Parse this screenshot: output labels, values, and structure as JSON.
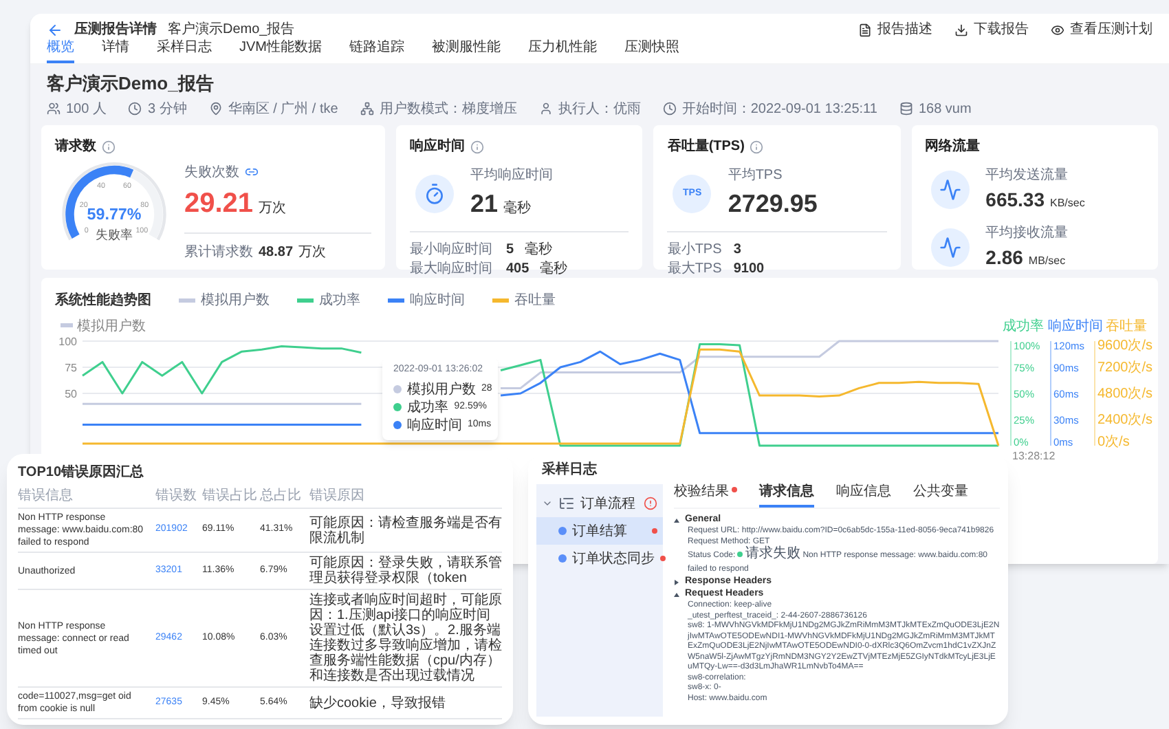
{
  "header": {
    "title": "压测报告详情",
    "subtitle": "客户演示Demo_报告",
    "actions": [
      "报告描述",
      "下载报告",
      "查看压测计划"
    ]
  },
  "tabs": [
    {
      "label": "概览",
      "selected": true
    },
    {
      "label": "详情",
      "selected": false
    },
    {
      "label": "采样日志",
      "selected": false
    },
    {
      "label": "JVM性能数据",
      "selected": false
    },
    {
      "label": "链路追踪",
      "selected": false
    },
    {
      "label": "被测服性能",
      "selected": false
    },
    {
      "label": "压力机性能",
      "selected": false
    },
    {
      "label": "压测快照",
      "selected": false
    }
  ],
  "report": {
    "title": "客户演示Demo_报告",
    "meta": [
      "100 人",
      "3 分钟",
      "华南区 / 广州 / tke",
      "用户数模式：梯度增压",
      "执行人：优雨",
      "开始时间：2022-09-01 13:25:11",
      "168 vum"
    ]
  },
  "requests_card": {
    "title": "请求数",
    "gauge": {
      "level": 0.5977,
      "value": "59.77%",
      "label": "失败率",
      "ticks": [
        "0",
        "20",
        "40",
        "60",
        "80",
        "100"
      ]
    },
    "failures": {
      "label": "失败次数",
      "value": "29.21",
      "unit": "万次"
    },
    "total": {
      "label": "累计请求数",
      "value": "48.87",
      "unit": "万次"
    }
  },
  "response_card": {
    "title": "响应时间",
    "average": {
      "label": "平均响应时间",
      "value": "21",
      "unit": "毫秒"
    },
    "min": {
      "label": "最小响应时间",
      "value": "5",
      "unit": "毫秒"
    },
    "max": {
      "label": "最大响应时间",
      "value": "405",
      "unit": "毫秒"
    }
  },
  "tps_card": {
    "title": "吞吐量(TPS)",
    "badge": "TPS",
    "average": {
      "label": "平均TPS",
      "value": "2729.95"
    },
    "min": {
      "label": "最小TPS",
      "value": "3"
    },
    "max": {
      "label": "最大TPS",
      "value": "9100"
    }
  },
  "network_card": {
    "title": "网络流量",
    "items": [
      {
        "label": "平均发送流量",
        "value": "665.33",
        "unit": "KB/sec"
      },
      {
        "label": "平均接收流量",
        "value": "2.86",
        "unit": "MB/sec"
      }
    ]
  },
  "trend_chart": {
    "title": "系统性能趋势图",
    "chart_data": {
      "type": "line",
      "ylabel": "模拟用户数",
      "categories": [
        null,
        null,
        null,
        null,
        null,
        null,
        null,
        null,
        null,
        null,
        null,
        null,
        null,
        null,
        null,
        null,
        null,
        null,
        null,
        null,
        null,
        null,
        null,
        null,
        null,
        null,
        null,
        null,
        null,
        null,
        null,
        null,
        null,
        null,
        null,
        null,
        null,
        null,
        null,
        null,
        null,
        null,
        null,
        null,
        null,
        null,
        null
      ],
      "ylim": [
        0,
        100
      ],
      "yticks": [
        50,
        75,
        100
      ],
      "series": [
        {
          "name": "模拟用户数",
          "color": "#c5cbe0",
          "values": [
            40,
            40,
            40,
            40,
            40,
            40,
            40,
            40,
            40,
            40,
            40,
            40,
            40,
            40,
            40,
            null,
            null,
            null,
            null,
            null,
            null,
            55,
            55,
            70,
            70,
            70,
            70,
            70,
            70,
            70,
            70,
            85,
            85,
            85,
            85,
            85,
            85,
            85,
            100,
            100,
            100,
            100,
            100,
            100,
            100,
            100,
            100
          ]
        },
        {
          "name": "成功率",
          "color": "#3fcf8e",
          "values": [
            67,
            80,
            50,
            80,
            67,
            80,
            50,
            80,
            90,
            92,
            95,
            94,
            93,
            93,
            89,
            null,
            null,
            null,
            null,
            null,
            null,
            72,
            77,
            82,
            0,
            0,
            0,
            0,
            0,
            0,
            0,
            97,
            97,
            96,
            0,
            0,
            0,
            0,
            0,
            0,
            0,
            0,
            0,
            0,
            0,
            0,
            0
          ]
        },
        {
          "name": "响应时间",
          "color": "#3b82f6",
          "values": [
            20,
            20,
            20,
            20,
            20,
            20,
            20,
            20,
            20,
            20,
            20,
            20,
            20,
            20,
            20,
            null,
            null,
            null,
            null,
            null,
            null,
            48,
            50,
            60,
            75,
            80,
            90,
            78,
            82,
            88,
            82,
            12,
            12,
            12,
            12,
            12,
            12,
            12,
            12,
            12,
            12,
            12,
            12,
            12,
            12,
            12,
            12
          ]
        },
        {
          "name": "吞吐量",
          "color": "#f5b82e",
          "values": [
            2,
            2,
            2,
            2,
            2,
            2,
            2,
            2,
            2,
            2,
            2,
            2,
            2,
            2,
            2,
            2,
            2,
            2,
            2,
            2,
            2,
            2,
            2,
            2,
            2,
            2,
            2,
            2,
            2,
            2,
            2,
            92,
            92,
            90,
            48,
            48,
            48,
            47,
            48,
            55,
            60,
            60,
            61,
            60,
            60,
            59,
            0
          ]
        }
      ]
    },
    "x_label": "13:28:12",
    "right_axes": [
      {
        "label": "成功率",
        "color": "#3fcf8e",
        "ticks": [
          "100%",
          "75%",
          "50%",
          "25%",
          "0%"
        ]
      },
      {
        "label": "响应时间",
        "color": "#3b82f6",
        "ticks": [
          "120ms",
          "90ms",
          "60ms",
          "30ms",
          "0ms"
        ]
      },
      {
        "label": "吞吐量",
        "color": "#f5b82e",
        "ticks": [
          "9600次/s",
          "7200次/s",
          "4800次/s",
          "2400次/s",
          "0次/s"
        ]
      }
    ],
    "tooltip": {
      "time": "2022-09-01 13:26:02",
      "rows": [
        {
          "label": "模拟用户数",
          "value": "28",
          "color": "#c5cbe0"
        },
        {
          "label": "成功率",
          "value": "92.59%",
          "color": "#3fcf8e"
        },
        {
          "label": "响应时间",
          "value": "10ms",
          "color": "#3b82f6"
        }
      ]
    }
  },
  "error_summary": {
    "title": "TOP10错误原因汇总",
    "columns": [
      "错误信息",
      "错误数",
      "错误占比",
      "总占比",
      "错误原因"
    ],
    "rows": [
      {
        "message": "Non HTTP response message: www.baidu.com:80 failed to respond",
        "count": "201902",
        "error_share": "69.11%",
        "total_share": "41.31%",
        "reason": "可能原因：请检查服务端是否有限流机制"
      },
      {
        "message": "Unauthorized",
        "count": "33201",
        "error_share": "11.36%",
        "total_share": "6.79%",
        "reason": "可能原因：登录失败，请联系管理员获得登录权限（token"
      },
      {
        "message": "Non HTTP response message: connect or read timed out",
        "count": "29462",
        "error_share": "10.08%",
        "total_share": "6.03%",
        "reason": "连接或者响应时间超时，可能原因：1.压测api接口的响应时间设置过低（默认3s）。2.服务端连接数过多导致响应增加，请检查服务端性能数据（cpu/内存）和连接数是否出现过载情况"
      },
      {
        "message": "code=110027,msg=get oid from cookie is null",
        "count": "27635",
        "error_share": "9.45%",
        "total_share": "5.64%",
        "reason": "缺少cookie，导致报错"
      }
    ]
  },
  "sample_log": {
    "title": "采样日志",
    "tree": [
      {
        "label": "订单流程",
        "expanded": true,
        "error": true,
        "children": [
          {
            "label": "订单结算",
            "selected": true,
            "error": true
          },
          {
            "label": "订单状态同步",
            "selected": false,
            "error": true
          }
        ]
      }
    ],
    "tabs": [
      {
        "label": "校验结果",
        "selected": false,
        "alert": true
      },
      {
        "label": "请求信息",
        "selected": true,
        "alert": false
      },
      {
        "label": "响应信息",
        "selected": false,
        "alert": false
      },
      {
        "label": "公共变量",
        "selected": false,
        "alert": false
      }
    ],
    "sections": [
      {
        "title": "General",
        "expanded": true,
        "lines": [
          {
            "kind": "text",
            "text": "Request URL: http://www.baidu.com?ID=0c6ab5dc-155a-11ed-8056-9eca741b9826"
          },
          {
            "kind": "text",
            "text": "Request Method: GET"
          },
          {
            "kind": "status",
            "label": "Status Code:",
            "status": "请求失败",
            "message": "Non HTTP response message: www.baidu.com:80 failed to respond"
          }
        ]
      },
      {
        "title": "Response Headers",
        "expanded": false
      },
      {
        "title": "Request Headers",
        "expanded": true,
        "lines": [
          {
            "kind": "text",
            "text": "Connection: keep-alive"
          },
          {
            "kind": "text",
            "text": "_utest_perftest_traceid_: 2-44-2607-2886736126"
          },
          {
            "kind": "text",
            "text": "sw8: 1-MWVhNGVkMDFkMjU1NDg2MGJkZmRiMmM3MTJkMTExZmQuODE3LjE2NjIwMTAwOTE5ODEwNDI1-MWVhNGVkMDFkMjU1NDg2MGJkZmRiMmM3MTJkMTExZmQuODE3LjE2NjIwMTAwOTE5ODEwNDI0-0-dXRlc3Q6OmZvcm1hdC1vZXJnZW5naW5l-ZjAwMTgzYjRmNDM3NGY2Y2EwZTVjMTEzMjE5ZGIyNTdkMTcyLjE3LjEuMTQy-Lw==-d3d3LmJhaWR1LmNvbTo4MA=="
          },
          {
            "kind": "text",
            "text": "sw8-correlation:"
          },
          {
            "kind": "text",
            "text": "sw8-x: 0-"
          },
          {
            "kind": "text",
            "text": "Host: www.baidu.com"
          }
        ]
      }
    ]
  }
}
